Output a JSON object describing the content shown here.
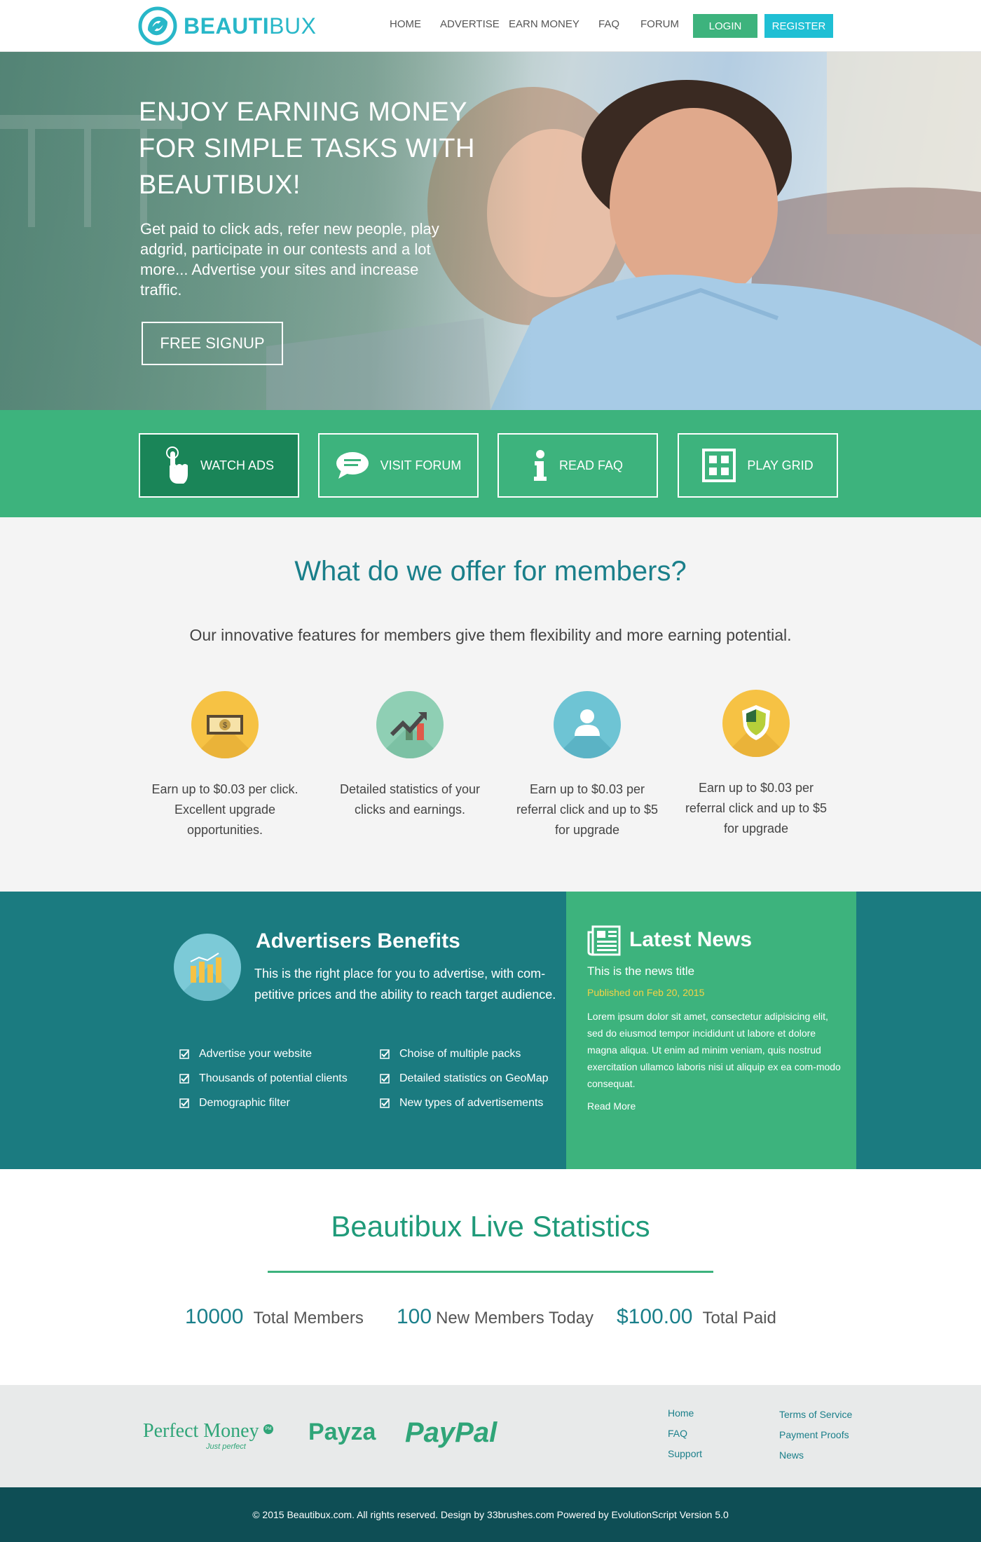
{
  "header": {
    "logo_bold": "BEAUTI",
    "logo_light": "BUX",
    "nav": [
      "HOME",
      "ADVERTISE",
      "EARN MONEY",
      "FAQ",
      "FORUM"
    ],
    "login": "LOGIN",
    "register": "REGISTER"
  },
  "hero": {
    "title": "ENJOY EARNING MONEY FOR SIMPLE TASKS WITH BEAUTIBUX!",
    "subtitle": "Get paid to click ads, refer new people, play adgrid, participate in our contests and a lot more... Advertise your sites and increase traffic.",
    "cta": "FREE SIGNUP"
  },
  "actions": [
    {
      "label": "WATCH ADS",
      "icon": "hand-pointer-icon"
    },
    {
      "label": "VISIT FORUM",
      "icon": "chat-bubble-icon"
    },
    {
      "label": "READ FAQ",
      "icon": "info-icon"
    },
    {
      "label": "PLAY GRID",
      "icon": "grid-icon"
    }
  ],
  "offers": {
    "title": "What do we offer for members?",
    "subtitle": "Our innovative features for members give them flexibility and more earning potential.",
    "features": [
      {
        "icon": "money-bill-icon",
        "text": "Earn up to $0.03 per click.  Excellent upgrade opportunities."
      },
      {
        "icon": "chart-arrow-icon",
        "text": "Detailed statistics of your clicks and earnings."
      },
      {
        "icon": "user-icon",
        "text": "Earn up to $0.03 per referral click and up to $5 for upgrade"
      },
      {
        "icon": "shield-icon",
        "text": "Earn up to $0.03 per referral click and up to $5 for upgrade"
      }
    ]
  },
  "advertisers": {
    "title": "Advertisers Benefits",
    "description": "This is the right place for you to advertise, with com-petitive prices and the ability to reach target audience.",
    "list_left": [
      "Advertise your website",
      "Thousands of potential clients",
      "Demographic filter"
    ],
    "list_right": [
      "Choise of multiple packs",
      "Detailed statistics on GeoMap",
      "New types of advertisements"
    ]
  },
  "news": {
    "title": "Latest News",
    "item_title": "This is the news title",
    "date": "Published on Feb 20, 2015",
    "body": "Lorem ipsum dolor sit amet, consectetur adipisicing elit, sed do eiusmod tempor incididunt ut labore et dolore magna aliqua. Ut enim ad minim veniam, quis nostrud exercitation ullamco laboris nisi ut aliquip ex ea com-modo consequat.",
    "read_more": "Read More"
  },
  "stats": {
    "title": "Beautibux Live Statistics",
    "items": [
      {
        "value": "10000",
        "label": "Total Members"
      },
      {
        "value": "100",
        "label": "New Members Today"
      },
      {
        "value": "$100.00",
        "label": "Total Paid"
      }
    ]
  },
  "footer": {
    "payments": {
      "perfect_money": "Perfect Money",
      "perfect_money_tag": "Just perfect",
      "perfect_money_badge": "PM",
      "payza": "Payza",
      "paypal": "PayPal"
    },
    "links_left": [
      "Home",
      "FAQ",
      "Support"
    ],
    "links_right": [
      "Terms of Service",
      "Payment Proofs",
      "News"
    ],
    "copyright": "© 2015 Beautibux.com. All rights reserved.  Design by 33brushes.com Powered by EvolutionScript Version 5.0"
  },
  "colors": {
    "brand_cyan": "#28b7c8",
    "green": "#3db37d",
    "dark_green": "#1a8558",
    "teal": "#1b7b80",
    "footer_dark": "#0e4e55",
    "news_date": "#f5d245"
  }
}
